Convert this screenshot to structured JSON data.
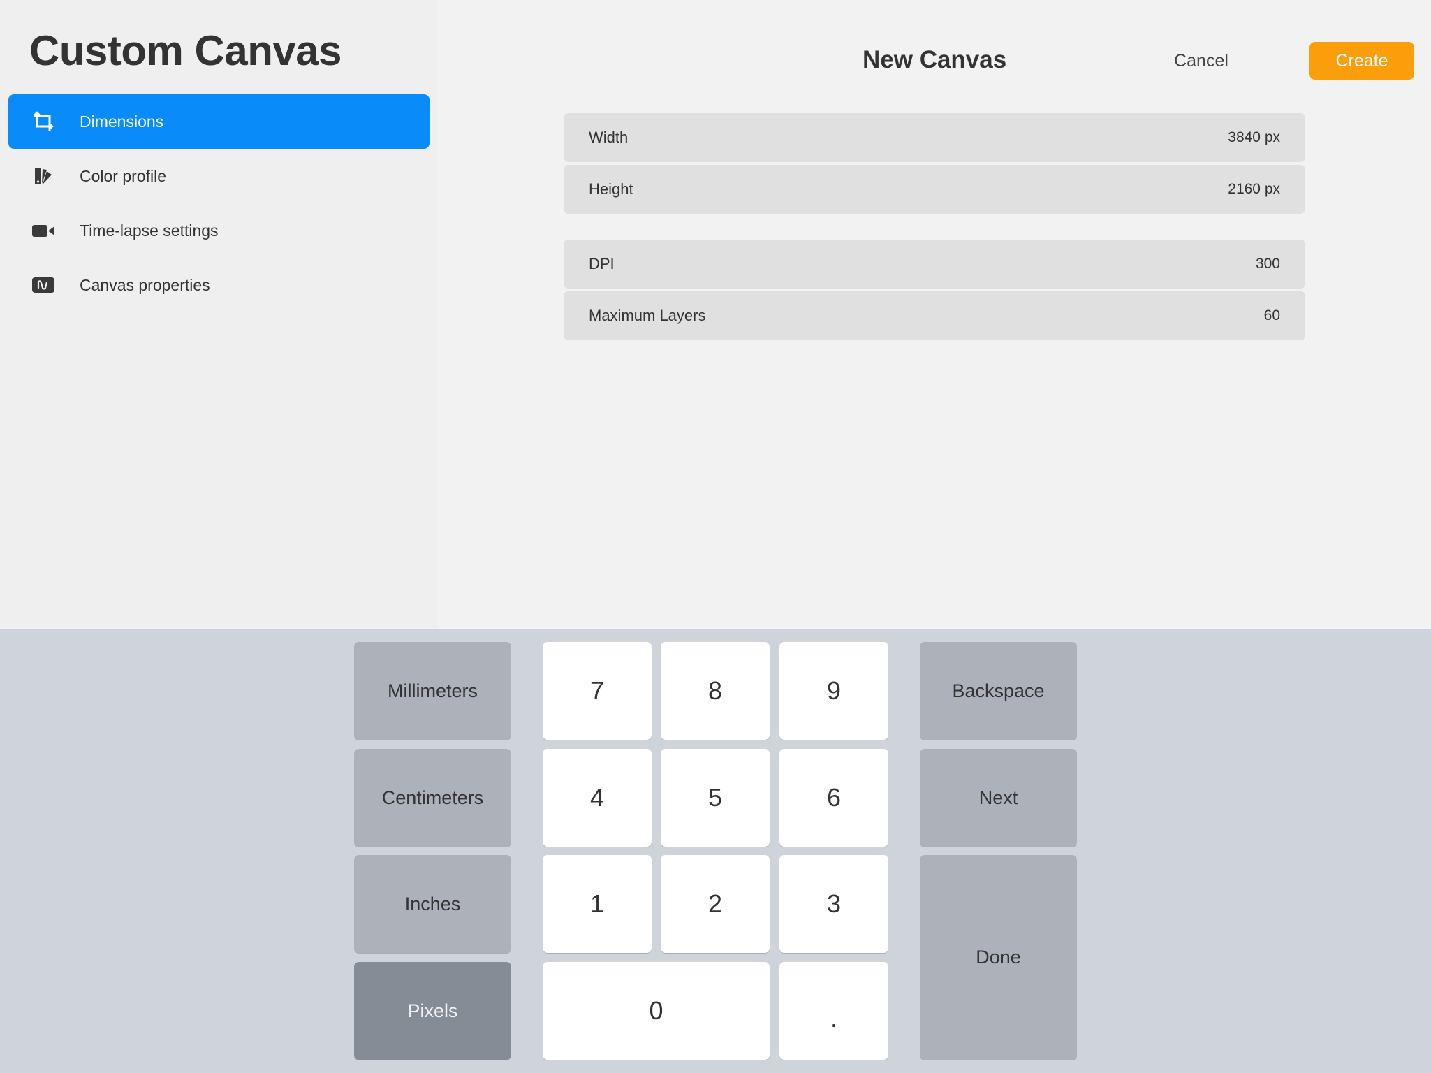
{
  "sidebar": {
    "title": "Custom Canvas",
    "items": [
      {
        "label": "Dimensions",
        "icon": "crop-icon",
        "active": true
      },
      {
        "label": "Color profile",
        "icon": "color-swatch-icon",
        "active": false
      },
      {
        "label": "Time-lapse settings",
        "icon": "video-camera-icon",
        "active": false
      },
      {
        "label": "Canvas properties",
        "icon": "canvas-properties-icon",
        "active": false
      }
    ]
  },
  "header": {
    "title": "New Canvas",
    "cancel_label": "Cancel",
    "create_label": "Create"
  },
  "fields": [
    {
      "label": "Width",
      "value": "3840 px"
    },
    {
      "label": "Height",
      "value": "2160 px"
    },
    {
      "label": "DPI",
      "value": "300"
    },
    {
      "label": "Maximum Layers",
      "value": "60"
    }
  ],
  "keypad": {
    "units": [
      {
        "label": "Millimeters",
        "selected": false
      },
      {
        "label": "Centimeters",
        "selected": false
      },
      {
        "label": "Inches",
        "selected": false
      },
      {
        "label": "Pixels",
        "selected": true
      }
    ],
    "digits": {
      "seven": "7",
      "eight": "8",
      "nine": "9",
      "four": "4",
      "five": "5",
      "six": "6",
      "one": "1",
      "two": "2",
      "three": "3",
      "zero": "0",
      "decimal": "."
    },
    "actions": {
      "backspace": "Backspace",
      "next": "Next",
      "done": "Done"
    }
  },
  "colors": {
    "accent_blue": "#0a8bfa",
    "create_orange": "#fb9e0b",
    "keypad_bg": "#cfd3da",
    "unit_key": "#acb1ba",
    "unit_key_selected": "#858c96"
  }
}
